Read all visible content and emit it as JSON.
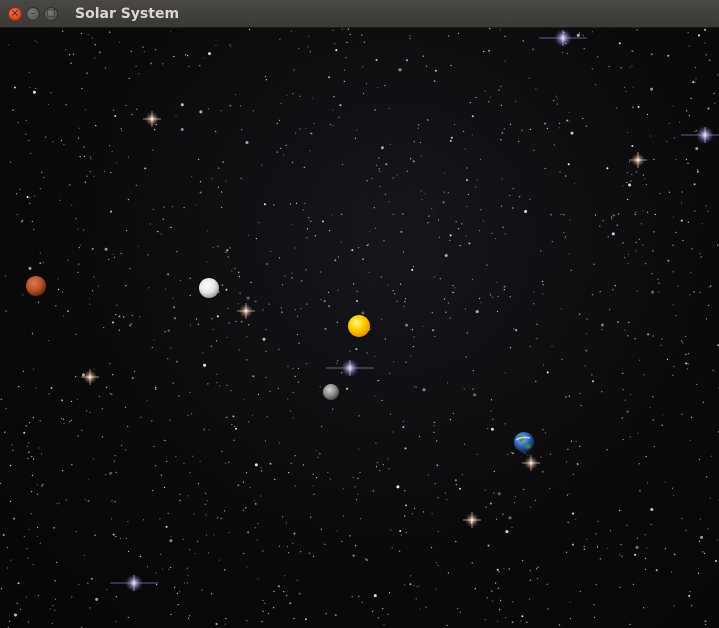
{
  "window": {
    "title": "Solar System",
    "buttons": {
      "close_glyph": "×",
      "minimize_glyph": "–",
      "maximize_glyph": "□"
    }
  },
  "colors": {
    "sun": "#ffcc00",
    "mars": "#b8502c",
    "earth": "#2f65b8",
    "moon": "#f2f2f2",
    "mercury": "#9a9a9a",
    "space": "#0b0a0b"
  }
}
